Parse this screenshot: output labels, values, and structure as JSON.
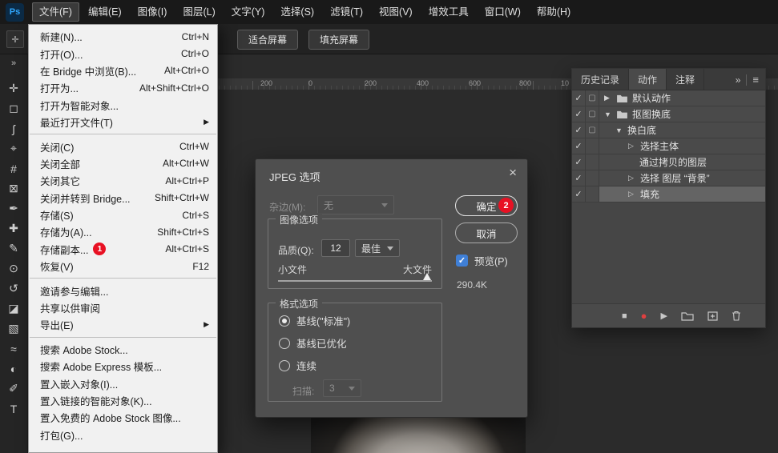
{
  "colors": {
    "badge_red": "#e81123",
    "checkbox_blue": "#3f7fd6",
    "logo_blue": "#31a8ff",
    "record_red": "#df4040"
  },
  "menubar": {
    "logo": "Ps",
    "items": [
      {
        "label": "文件(F)",
        "cls": "active"
      },
      {
        "label": "编辑(E)"
      },
      {
        "label": "图像(I)"
      },
      {
        "label": "图层(L)"
      },
      {
        "label": "文字(Y)"
      },
      {
        "label": "选择(S)"
      },
      {
        "label": "滤镜(T)"
      },
      {
        "label": "视图(V)"
      },
      {
        "label": "增效工具"
      },
      {
        "label": "窗口(W)"
      },
      {
        "label": "帮助(H)"
      }
    ]
  },
  "options_bar": {
    "fit_screen": "适合屏幕",
    "fill_screen": "填充屏幕"
  },
  "toolbar": {
    "collapse_icon": "»",
    "tools": [
      {
        "name": "move-tool",
        "glyph": "✛"
      },
      {
        "name": "rectangular-marquee-tool",
        "glyph": "◻"
      },
      {
        "name": "lasso-tool",
        "glyph": "ʃ"
      },
      {
        "name": "object-selection-tool",
        "glyph": "⌖"
      },
      {
        "name": "crop-tool",
        "glyph": "#"
      },
      {
        "name": "frame-tool",
        "glyph": "⊠"
      },
      {
        "name": "eyedropper-tool",
        "glyph": "✒"
      },
      {
        "name": "spot-healing-brush-tool",
        "glyph": "✚"
      },
      {
        "name": "brush-tool",
        "glyph": "✎"
      },
      {
        "name": "clone-stamp-tool",
        "glyph": "⊙"
      },
      {
        "name": "history-brush-tool",
        "glyph": "↺"
      },
      {
        "name": "eraser-tool",
        "glyph": "◪"
      },
      {
        "name": "gradient-tool",
        "glyph": "▧"
      },
      {
        "name": "blur-tool",
        "glyph": "≈"
      },
      {
        "name": "dodge-tool",
        "glyph": "◐"
      },
      {
        "name": "pen-tool",
        "glyph": "✐"
      },
      {
        "name": "type-tool",
        "glyph": "T"
      }
    ]
  },
  "ruler": {
    "labels": [
      "200",
      "0",
      "200",
      "400",
      "600",
      "800",
      "10"
    ]
  },
  "file_menu": {
    "items": [
      {
        "label": "新建(N)...",
        "shortcut": "Ctrl+N"
      },
      {
        "label": "打开(O)...",
        "shortcut": "Ctrl+O"
      },
      {
        "label": "在 Bridge 中浏览(B)...",
        "shortcut": "Alt+Ctrl+O"
      },
      {
        "label": "打开为...",
        "shortcut": "Alt+Shift+Ctrl+O"
      },
      {
        "label": "打开为智能对象..."
      },
      {
        "label": "最近打开文件(T)",
        "arrow": "▶"
      },
      {
        "cls": "separator"
      },
      {
        "label": "关闭(C)",
        "shortcut": "Ctrl+W"
      },
      {
        "label": "关闭全部",
        "shortcut": "Alt+Ctrl+W"
      },
      {
        "label": "关闭其它",
        "shortcut": "Alt+Ctrl+P"
      },
      {
        "label": "关闭并转到 Bridge...",
        "shortcut": "Shift+Ctrl+W"
      },
      {
        "label": "存储(S)",
        "shortcut": "Ctrl+S"
      },
      {
        "label": "存储为(A)...",
        "shortcut": "Shift+Ctrl+S"
      },
      {
        "label": "存储副本...",
        "badge": "1",
        "shortcut": "Alt+Ctrl+S"
      },
      {
        "label": "恢复(V)",
        "shortcut": "F12"
      },
      {
        "cls": "separator"
      },
      {
        "label": "邀请参与编辑..."
      },
      {
        "label": "共享以供审阅"
      },
      {
        "label": "导出(E)",
        "arrow": "▶"
      },
      {
        "cls": "separator"
      },
      {
        "label": "搜索 Adobe Stock..."
      },
      {
        "label": "搜索 Adobe Express 模板..."
      },
      {
        "label": "置入嵌入对象(I)..."
      },
      {
        "label": "置入链接的智能对象(K)..."
      },
      {
        "label": "置入免费的 Adobe Stock 图像..."
      },
      {
        "label": "打包(G)..."
      }
    ]
  },
  "dialog": {
    "title": "JPEG 选项",
    "close_icon": "×",
    "matte_label": "杂边(M):",
    "matte_value": "无",
    "ok_label": "确定",
    "ok_badge": "2",
    "cancel_label": "取消",
    "preview": {
      "label": "预览(P)",
      "checked": true,
      "check_glyph": "✓"
    },
    "file_size": "290.4K",
    "image_options": {
      "legend": "图像选项",
      "quality_label": "品质(Q):",
      "quality_value": "12",
      "quality_preset": "最佳",
      "slider_left": "小文件",
      "slider_right": "大文件"
    },
    "format_options": {
      "legend": "格式选项",
      "radios": [
        {
          "label": "基线(\"标准\")",
          "selected": true
        },
        {
          "label": "基线已优化"
        },
        {
          "label": "连续"
        }
      ],
      "scans_label": "扫描:",
      "scans_value": "3"
    }
  },
  "actions_panel": {
    "tabs": [
      {
        "label": "历史记录"
      },
      {
        "label": "动作",
        "cls": "active"
      },
      {
        "label": "注释"
      }
    ],
    "collapse_icon": "»",
    "menu_icon": "≡",
    "rows": [
      {
        "check": "✓",
        "toggle": "▢",
        "arrow": "▶",
        "folder": true,
        "label": "默认动作",
        "cls": "lvl-0"
      },
      {
        "check": "✓",
        "toggle": "▢",
        "arrow": "▼",
        "folder": true,
        "label": "抠图换底",
        "cls": "lvl-0"
      },
      {
        "check": "✓",
        "toggle": "▢",
        "arrow": "▼",
        "label": "换白底",
        "cls": "lvl-1"
      },
      {
        "check": "✓",
        "arrow": "▷",
        "label": "选择主体",
        "cls": "lvl-2"
      },
      {
        "check": "✓",
        "label": "通过拷贝的图层",
        "cls": "lvl-3"
      },
      {
        "check": "✓",
        "arrow": "▷",
        "label": "选择 图层 “背景”",
        "cls": "lvl-2"
      },
      {
        "check": "✓",
        "arrow": "▷",
        "label": "填充",
        "cls": "lvl-2 selected"
      }
    ],
    "footer": {
      "stop_icon": "■",
      "record_icon": "●",
      "play_icon": "▶"
    }
  }
}
